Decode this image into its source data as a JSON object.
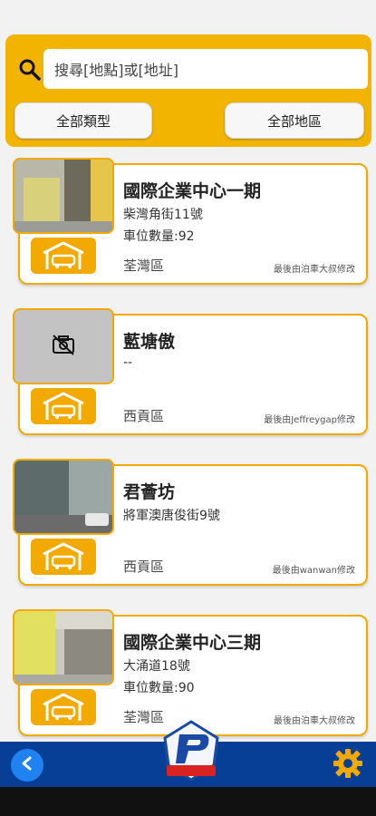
{
  "search": {
    "placeholder": "搜尋[地點]或[地址]",
    "filter_type_label": "全部類型",
    "filter_area_label": "全部地區"
  },
  "cards": [
    {
      "title": "國際企業中心一期",
      "line1": "柴灣角街11號",
      "line2": "車位數量:92",
      "district": "荃灣區",
      "editor": "最後由泊車大叔修改",
      "has_photo": true
    },
    {
      "title": "藍塘傲",
      "line1": "--",
      "line2": "",
      "district": "西貢區",
      "editor": "最後由Jeffreygap修改",
      "has_photo": false
    },
    {
      "title": "君薈坊",
      "line1": "將軍澳唐俊街9號",
      "line2": "",
      "district": "西貢區",
      "editor": "最後由wanwan修改",
      "has_photo": true
    },
    {
      "title": "國際企業中心三期",
      "line1": "大涌道18號",
      "line2": "車位數量:90",
      "district": "荃灣區",
      "editor": "最後由泊車大叔修改",
      "has_photo": true
    }
  ],
  "colors": {
    "accent": "#f2a900",
    "search_panel": "#f2b400",
    "bottom_bar": "#073f96",
    "back_button": "#1f82f0"
  },
  "icons": {
    "search": "search-icon",
    "car": "car-garage-icon",
    "no_photo": "camera-off-icon",
    "back": "chevron-left-icon",
    "settings": "gear-icon"
  }
}
